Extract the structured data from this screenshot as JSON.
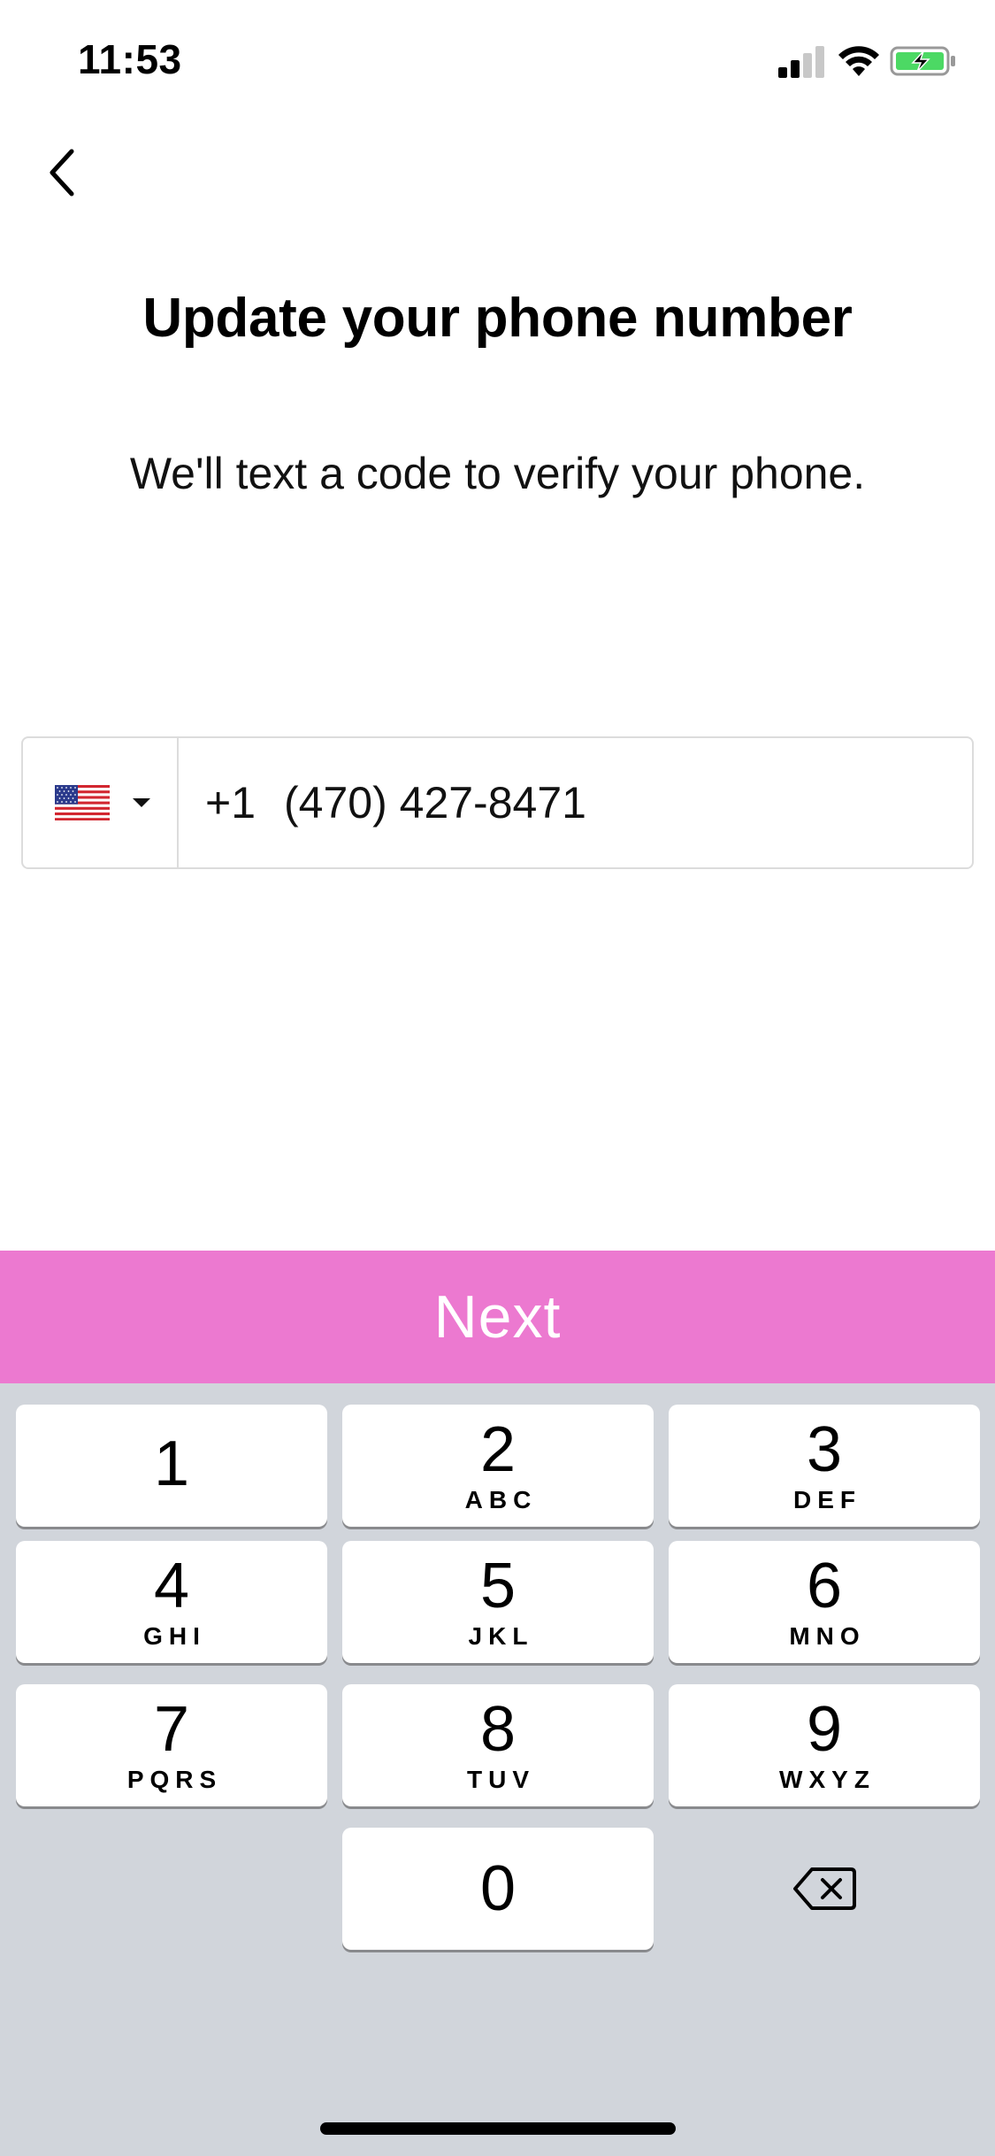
{
  "status_bar": {
    "time": "11:53"
  },
  "header": {
    "title": "Update your phone number",
    "subtitle": "We'll text a code to verify your phone."
  },
  "phone": {
    "country_flag": "us-flag-icon",
    "dial_code": "+1",
    "number": "(470) 427-8471"
  },
  "next_button": {
    "label": "Next",
    "color": "#ec79d0"
  },
  "keypad": {
    "keys": [
      {
        "num": "1",
        "letters": ""
      },
      {
        "num": "2",
        "letters": "ABC"
      },
      {
        "num": "3",
        "letters": "DEF"
      },
      {
        "num": "4",
        "letters": "GHI"
      },
      {
        "num": "5",
        "letters": "JKL"
      },
      {
        "num": "6",
        "letters": "MNO"
      },
      {
        "num": "7",
        "letters": "PQRS"
      },
      {
        "num": "8",
        "letters": "TUV"
      },
      {
        "num": "9",
        "letters": "WXYZ"
      },
      {
        "num": "0",
        "letters": ""
      }
    ],
    "delete_icon": "delete-backspace-icon",
    "background": "#d1d5db"
  }
}
